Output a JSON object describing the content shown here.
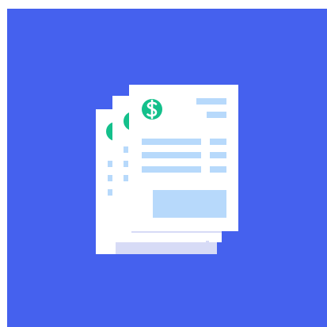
{
  "illustration": {
    "subject": "stacked-invoice-documents",
    "icons": [
      "dollar-icon"
    ],
    "document_count": 3
  },
  "colors": {
    "background": "#4561EE",
    "paper": "#FFFFFF",
    "accent_green": "#14C08B",
    "line_blue": "#B7D9FB",
    "shadow_lavender": "#D7DBF6"
  }
}
